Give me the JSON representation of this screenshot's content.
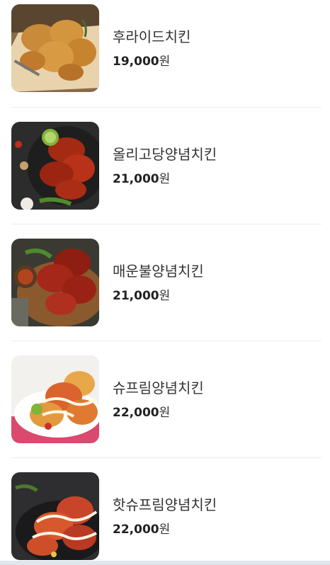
{
  "menu": {
    "items": [
      {
        "name": "후라이드치킨",
        "price": "19,000",
        "currency": "원",
        "image": "fried-chicken-photo"
      },
      {
        "name": "올리고당양념치킨",
        "price": "21,000",
        "currency": "원",
        "image": "oligo-yangnyeom-chicken-photo"
      },
      {
        "name": "매운불양념치킨",
        "price": "21,000",
        "currency": "원",
        "image": "spicy-fire-yangnyeom-chicken-photo"
      },
      {
        "name": "슈프림양념치킨",
        "price": "22,000",
        "currency": "원",
        "image": "supreme-yangnyeom-chicken-photo"
      },
      {
        "name": "핫슈프림양념치킨",
        "price": "22,000",
        "currency": "원",
        "image": "hot-supreme-yangnyeom-chicken-photo"
      }
    ]
  },
  "colors": {
    "name_text": "#333333",
    "price_text": "#222222",
    "divider": "#ececec",
    "background": "#ffffff"
  }
}
